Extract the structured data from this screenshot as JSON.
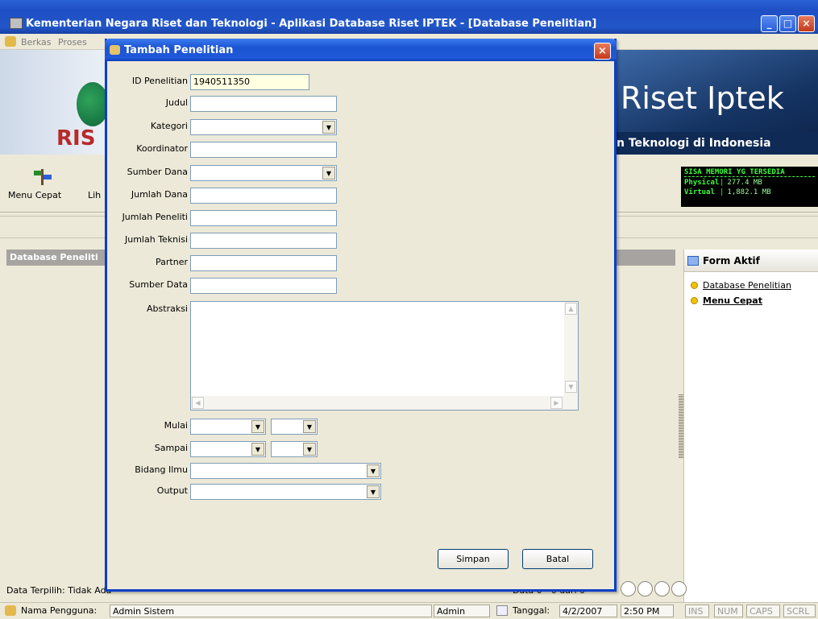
{
  "window": {
    "title": "Kementerian Negara Riset dan Teknologi - Aplikasi Database Riset IPTEK - [Database Penelitian]"
  },
  "menu": {
    "items": [
      "Berkas",
      "Proses"
    ]
  },
  "banner": {
    "big_text": "Riset Iptek",
    "strip_text": "n Teknologi di Indonesia",
    "logo_text": "RIS"
  },
  "toolbar": {
    "menu_cepat": "Menu Cepat",
    "lih": "Lih"
  },
  "memory": {
    "header": "SISA MEMORI YG TERSEDIA",
    "physical_label": "Physical",
    "physical_value": "277.4 MB",
    "virtual_label": "Virtual",
    "virtual_value": "1,882.1 MB"
  },
  "left_panel": {
    "header": "Database Peneliti"
  },
  "right_panel": {
    "header": "Form Aktif",
    "items": [
      "Database Penelitian",
      "Menu Cepat"
    ]
  },
  "footer": {
    "data_terpilih": "Data Terpilih: Tidak Ada",
    "record_text": "Data 0 - 0 dari 0"
  },
  "statusbar": {
    "user_label": "Nama Pengguna:",
    "user_value": "Admin Sistem",
    "role": "Admin",
    "date_label": "Tanggal:",
    "date_value": "4/2/2007",
    "time": "2:50 PM",
    "ins": "INS",
    "num": "NUM",
    "caps": "CAPS",
    "scrl": "SCRL"
  },
  "dialog": {
    "title": "Tambah Penelitian",
    "fields": {
      "id_label": "ID Penelitian",
      "id_value": "1940511350",
      "judul_label": "Judul",
      "kategori_label": "Kategori",
      "koordinator_label": "Koordinator",
      "sumber_dana_label": "Sumber Dana",
      "jumlah_dana_label": "Jumlah Dana",
      "jumlah_peneliti_label": "Jumlah Peneliti",
      "jumlah_teknisi_label": "Jumlah Teknisi",
      "partner_label": "Partner",
      "sumber_data_label": "Sumber Data",
      "abstraksi_label": "Abstraksi",
      "mulai_label": "Mulai",
      "sampai_label": "Sampai",
      "bidang_ilmu_label": "Bidang Ilmu",
      "output_label": "Output"
    },
    "buttons": {
      "simpan": "Simpan",
      "batal": "Batal"
    }
  }
}
